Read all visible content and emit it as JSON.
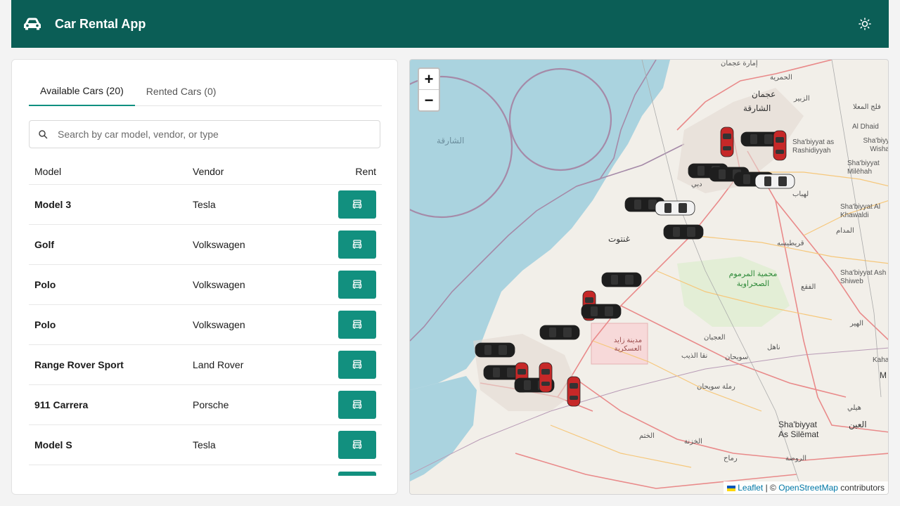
{
  "header": {
    "title": "Car Rental App",
    "icon": "car-icon",
    "theme_icon": "sun-icon"
  },
  "tabs": [
    {
      "label": "Available Cars (20)",
      "active": true
    },
    {
      "label": "Rented Cars (0)",
      "active": false
    }
  ],
  "search": {
    "placeholder": "Search by car model, vendor, or type",
    "value": ""
  },
  "table": {
    "headers": {
      "model": "Model",
      "vendor": "Vendor",
      "rent": "Rent"
    },
    "rows": [
      {
        "model": "Model 3",
        "vendor": "Tesla"
      },
      {
        "model": "Golf",
        "vendor": "Volkswagen"
      },
      {
        "model": "Polo",
        "vendor": "Volkswagen"
      },
      {
        "model": "Polo",
        "vendor": "Volkswagen"
      },
      {
        "model": "Range Rover Sport",
        "vendor": "Land Rover"
      },
      {
        "model": "911 Carrera",
        "vendor": "Porsche"
      },
      {
        "model": "Model S",
        "vendor": "Tesla"
      }
    ]
  },
  "map": {
    "zoom_in": "+",
    "zoom_out": "−",
    "attribution": {
      "leaflet": "Leaflet",
      "sep": "| ©",
      "osm": "OpenStreetMap",
      "suffix": "contributors"
    },
    "labels": {
      "ajman_emirate": "إمارة عجمان",
      "hamriya": "الحمرية",
      "ajman": "عجمان",
      "sharjah": "الشارقة",
      "zubair": "الزبير",
      "sharjah_sea": "الشارقة",
      "falaj": "فلج المعلا",
      "al_dhaid": "Al Dhaid",
      "shabiyyat_rashidiyyah": "Sha'biyyat as Rashidiyyah",
      "wisha": "Sha'biyy Wisha",
      "milehah": "Sha'biyyat Milēhah",
      "dubai": "دبي",
      "lehbab": "لهباب",
      "khawaldi": "Sha'biyyat Al Khawaldi",
      "madam": "المدام",
      "ghantoot": "غنتوت",
      "qureyyisah": "قريطيسه",
      "marmoom": "محمية المرموم الصحراوية",
      "shiweb": "Sha'biyyat Ash Shiweb",
      "faqaa": "الفقع",
      "hair": "الهير",
      "zayed_city": "مدينة زايد العسكرية",
      "ajban": "العجبان",
      "nahel": "ناهل",
      "naqa": "نقا الذيب",
      "sweihan": "سويحان",
      "ramlat": "رملة سويحان",
      "khatam": "الختم",
      "hili": "هيلي",
      "ain": "العين",
      "silemat": "Sha'biyyat As Silēmat",
      "khaznah": "الخزنة",
      "ramah": "رماح",
      "rawdah": "الروضة",
      "kaha": "Kaha",
      "m": "M"
    }
  },
  "colors": {
    "header": "#0b5e56",
    "accent": "#12907f",
    "water": "#aad3df",
    "land": "#f2efe9"
  }
}
